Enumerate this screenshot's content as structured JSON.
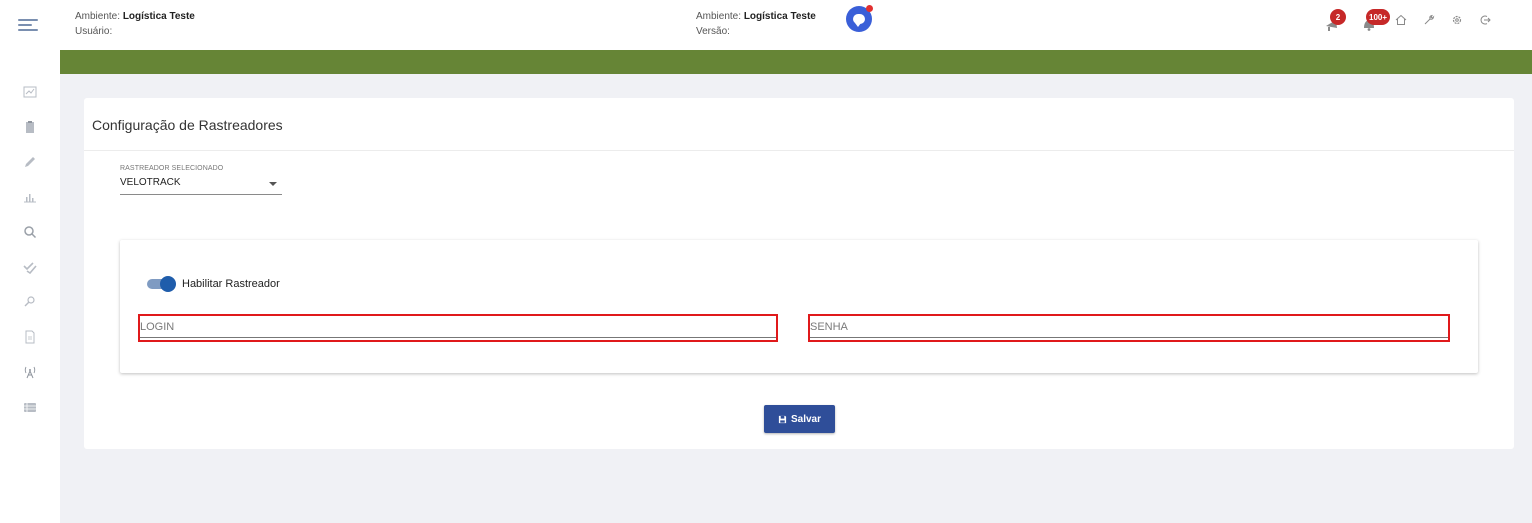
{
  "header": {
    "left": {
      "ambiente_label": "Ambiente:",
      "ambiente_value": "Logística Teste",
      "usuario_label": "Usuário:"
    },
    "middle": {
      "ambiente_label": "Ambiente:",
      "ambiente_value": "Logística Teste",
      "versao_label": "Versão:"
    },
    "notifications": [
      {
        "icon": "megaphone-icon",
        "count": "2"
      },
      {
        "icon": "bell-icon",
        "count": "100+"
      }
    ],
    "icons": [
      "home-icon",
      "wrench-icon",
      "settings-icon",
      "logout-icon"
    ]
  },
  "sidebar": {
    "items": [
      "dashboard-chart-icon",
      "clipboard-icon",
      "pencil-icon",
      "bar-chart-icon",
      "search-icon",
      "double-check-icon",
      "tools-icon",
      "document-icon",
      "antenna-icon",
      "list-icon"
    ]
  },
  "card": {
    "title": "Configuração de Rastreadores",
    "select": {
      "label": "RASTREADOR SELECIONADO",
      "value": "VELOTRACK"
    },
    "toggle": {
      "label": "Habilitar Rastreador",
      "on": true
    },
    "login": {
      "placeholder": "LOGIN",
      "value": ""
    },
    "senha": {
      "placeholder": "SENHA",
      "value": ""
    },
    "save_label": "Salvar"
  },
  "colors": {
    "green_band": "#668536",
    "primary": "#2f4e99",
    "badge": "#c62828",
    "highlight_border": "#e0191b"
  }
}
